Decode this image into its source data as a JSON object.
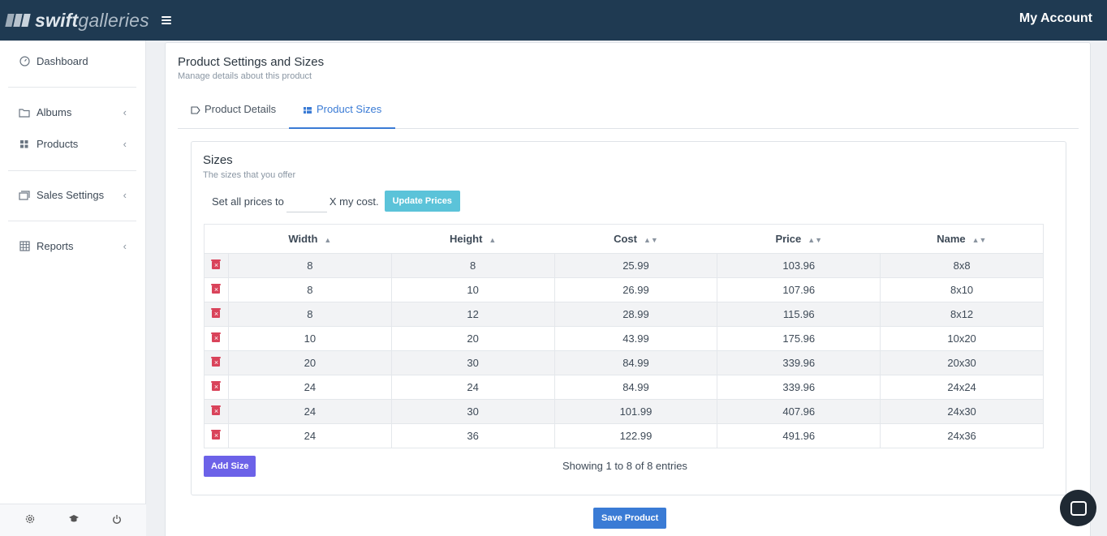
{
  "header": {
    "logo_bold": "swift",
    "logo_light": "galleries",
    "account_label": "My Account"
  },
  "sidebar": {
    "items": [
      {
        "label": "Dashboard",
        "icon": "dashboard-icon"
      },
      {
        "label": "Albums",
        "icon": "folder-icon"
      },
      {
        "label": "Products",
        "icon": "grid-icon"
      },
      {
        "label": "Sales Settings",
        "icon": "sales-icon"
      },
      {
        "label": "Reports",
        "icon": "table-icon"
      }
    ],
    "footer_icons": [
      "gear-icon",
      "graduation-cap-icon",
      "power-icon"
    ]
  },
  "card": {
    "title": "Product Settings and Sizes",
    "subtitle": "Manage details about this product",
    "tabs": [
      {
        "label": "Product Details",
        "active": false
      },
      {
        "label": "Product Sizes",
        "active": true
      }
    ]
  },
  "sizes": {
    "title": "Sizes",
    "subtitle": "The sizes that you offer",
    "set_prices_prefix": "Set all prices to",
    "set_prices_suffix": "X my cost.",
    "multiplier_value": "",
    "update_button": "Update Prices",
    "columns": [
      "Width",
      "Height",
      "Cost",
      "Price",
      "Name"
    ],
    "rows": [
      {
        "width": "8",
        "height": "8",
        "cost": "25.99",
        "price": "103.96",
        "name": "8x8"
      },
      {
        "width": "8",
        "height": "10",
        "cost": "26.99",
        "price": "107.96",
        "name": "8x10"
      },
      {
        "width": "8",
        "height": "12",
        "cost": "28.99",
        "price": "115.96",
        "name": "8x12"
      },
      {
        "width": "10",
        "height": "20",
        "cost": "43.99",
        "price": "175.96",
        "name": "10x20"
      },
      {
        "width": "20",
        "height": "30",
        "cost": "84.99",
        "price": "339.96",
        "name": "20x30"
      },
      {
        "width": "24",
        "height": "24",
        "cost": "84.99",
        "price": "339.96",
        "name": "24x24"
      },
      {
        "width": "24",
        "height": "30",
        "cost": "101.99",
        "price": "407.96",
        "name": "24x30"
      },
      {
        "width": "24",
        "height": "36",
        "cost": "122.99",
        "price": "491.96",
        "name": "24x36"
      }
    ],
    "add_button": "Add Size",
    "showing_text": "Showing 1 to 8 of 8 entries"
  },
  "save_button": "Save Product",
  "colors": {
    "topbar": "#1f3a52",
    "accent": "#3a7bd5",
    "update_button": "#5bc3d9",
    "add_button": "#6c62e8",
    "delete_icon": "#d9435a"
  }
}
